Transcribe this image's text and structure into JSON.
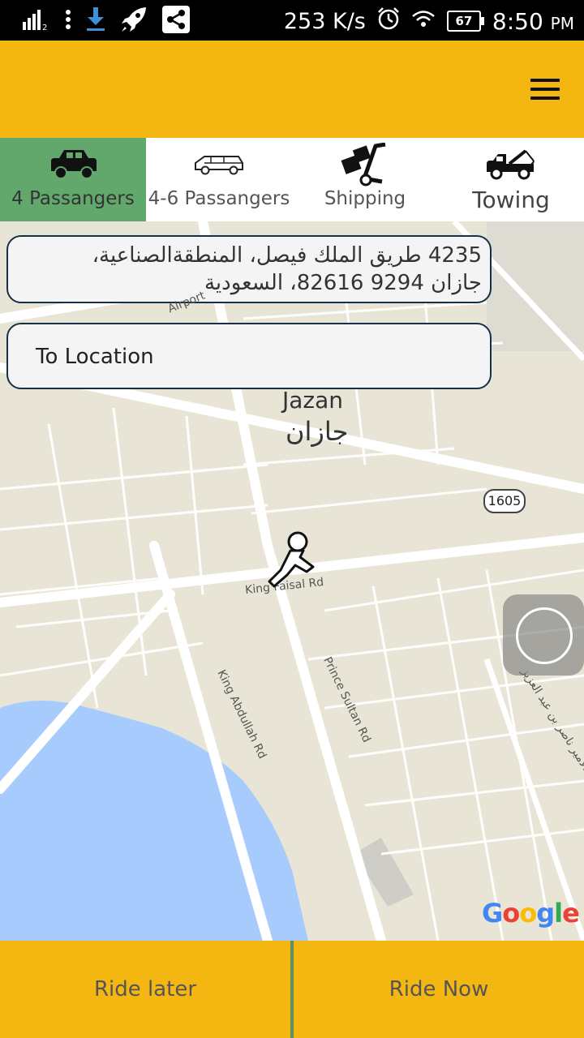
{
  "status_bar": {
    "speed": "253 K/s",
    "battery": "67",
    "time": "8:50",
    "ampm": "PM",
    "icons": [
      "signal-icon",
      "more-vert-icon",
      "download-icon",
      "rocket-icon",
      "share-icon",
      "alarm-icon",
      "wifi-icon",
      "battery-icon"
    ]
  },
  "app_bar": {
    "menu_icon": "hamburger-menu-icon",
    "color": "#f4b711"
  },
  "tabs": [
    {
      "label": "4 Passangers",
      "icon": "car-icon",
      "active": true
    },
    {
      "label": "4-6 Passangers",
      "icon": "station-wagon-icon",
      "active": false
    },
    {
      "label": "Shipping",
      "icon": "hand-truck-icon",
      "active": false
    },
    {
      "label": "Towing",
      "icon": "tow-truck-icon",
      "active": false
    }
  ],
  "from_location": {
    "line1": "4235 طريق الملك فيصل، المنطقةالصناعية،",
    "line2": "جازان 9294 82616، السعودية"
  },
  "to_location": {
    "placeholder": "To Location"
  },
  "map": {
    "city_en": "Jazan",
    "city_ar": "جازان",
    "roads": {
      "airport": "Airport",
      "king_faisal": "King Faisal Rd",
      "king_abdullah": "King Abdullah Rd",
      "prince_sultan": "Prince Sultan Rd",
      "arabic_street": "الامير ناصر بن عبد العزيز"
    },
    "route_shield": "1605",
    "attribution": "Google",
    "colors": {
      "land": "#e9e5d6",
      "water": "#a8cbfd",
      "road": "#ffffff"
    }
  },
  "bottom": {
    "ride_later": "Ride later",
    "ride_now": "Ride Now"
  }
}
